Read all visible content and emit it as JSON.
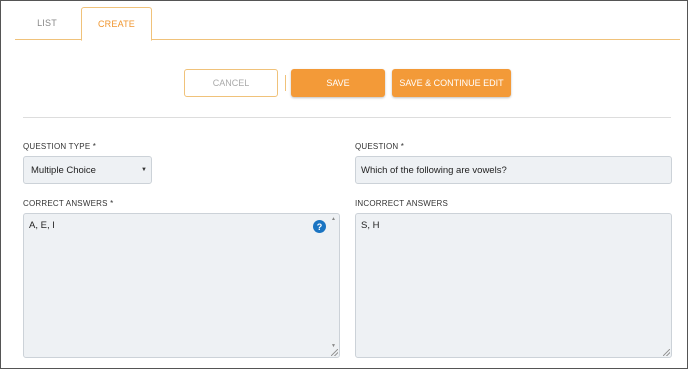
{
  "tabs": [
    {
      "label": "LIST",
      "active": false
    },
    {
      "label": "CREATE",
      "active": true
    }
  ],
  "actions": {
    "cancel_label": "CANCEL",
    "save_label": "SAVE",
    "save_continue_label": "SAVE & CONTINUE EDIT"
  },
  "form": {
    "question_type": {
      "label": "QUESTION TYPE *",
      "value": "Multiple Choice"
    },
    "question": {
      "label": "QUESTION *",
      "value": "Which of the following are vowels?"
    },
    "correct_answers": {
      "label": "CORRECT ANSWERS *",
      "value": "A, E, I",
      "help_glyph": "?"
    },
    "incorrect_answers": {
      "label": "INCORRECT ANSWERS",
      "value": "S, H"
    }
  },
  "colors": {
    "accent": "#f39a38",
    "accent_border": "#f0c27a",
    "help_blue": "#1a74c2",
    "field_bg": "#eef1f4"
  }
}
